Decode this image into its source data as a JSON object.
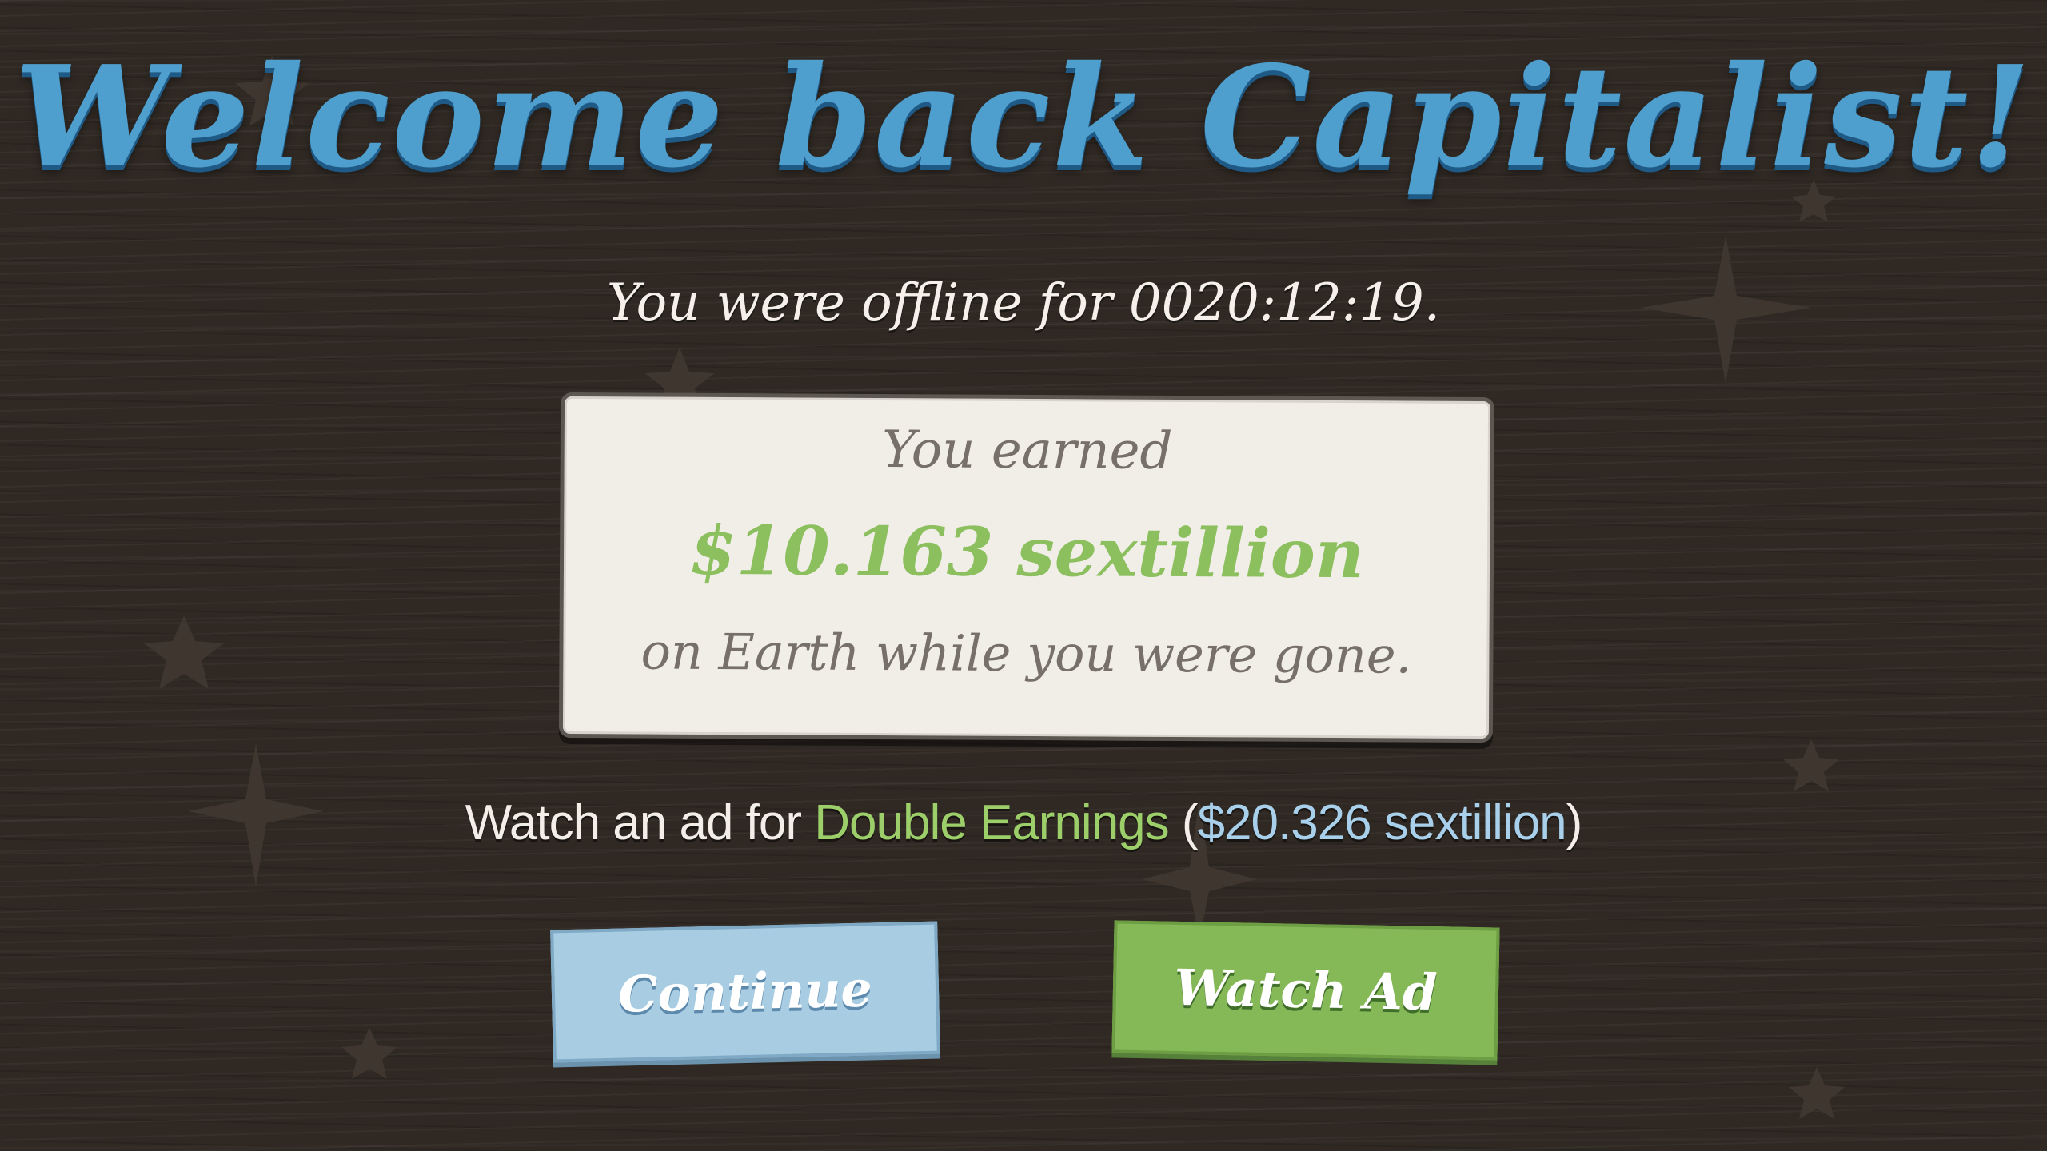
{
  "header": {
    "title": "Welcome back Capitalist!"
  },
  "offline": {
    "text": "You were offline for 0020:12:19."
  },
  "earnings_panel": {
    "label": "You earned",
    "amount": "$10.163 sextillion",
    "suffix": "on Earth while you were gone."
  },
  "ad_offer": {
    "prefix": "Watch an ad for ",
    "highlight": "Double Earnings",
    "open_paren": " (",
    "amount": "$20.326 sextillion",
    "close_paren": ")"
  },
  "buttons": {
    "continue_label": "Continue",
    "watch_ad_label": "Watch Ad"
  },
  "colors": {
    "background": "#2f2823",
    "title_blue": "#4f9fce",
    "money_green": "#8cbf5e",
    "continue_blue": "#a8cde3",
    "watch_ad_green": "#85b857",
    "panel_cream": "#f1eee8"
  }
}
